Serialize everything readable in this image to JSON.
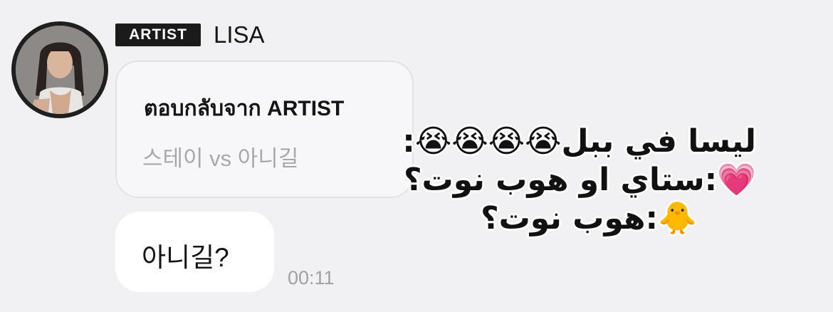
{
  "sender": {
    "badge": "ARTIST",
    "name": "LISA",
    "avatar_icon": "profile-photo"
  },
  "reply": {
    "header": "ตอบกลับจาก ARTIST",
    "quoted_text": "스테이 vs 아니길"
  },
  "message": {
    "text": "아니길?",
    "time": "00:11"
  },
  "overlay": {
    "lines": [
      "ليسا في ببل😭😭😭😭:",
      "💗:ستاي او هوب نوت؟",
      "🐥:هوب نوت؟"
    ]
  },
  "colors": {
    "background": "#f1f1f3",
    "badge_bg": "#1b1b1b",
    "bubble": "#ffffff",
    "reply_bubble": "#f7f7f9",
    "muted_text": "#a8a8ab"
  }
}
